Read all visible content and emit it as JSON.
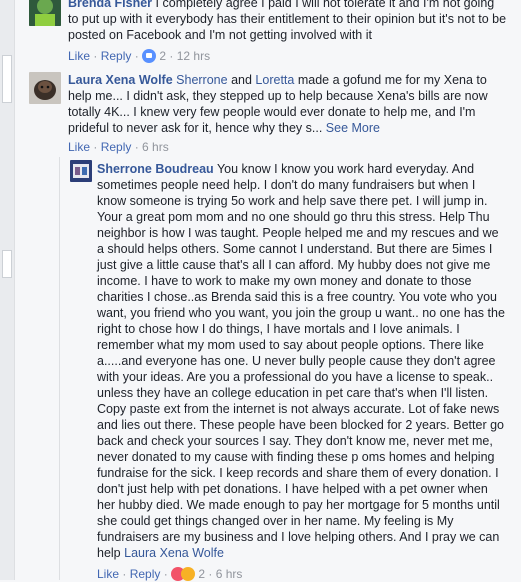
{
  "comments": [
    {
      "author": "Brenda Fisher",
      "text": "I completely agree I paid I will not tolerate it and I'm not going to put up with it everybody has their entitlement to their opinion but it's not to be posted on Facebook and I'm not getting involved with it",
      "actions": {
        "like": "Like",
        "reply": "Reply",
        "reaction_count": "2",
        "time": "12 hrs"
      }
    },
    {
      "author": "Laura Xena Wolfe",
      "mention1": "Sherrone",
      "and": "and",
      "mention2": "Loretta",
      "text": "made a gofund me for my Xena to help me... I didn't ask, they stepped up to help because Xena's bills are now totally 4K... I knew very few people would ever donate to help me, and I'm prideful to never ask for it, hence why they s...",
      "see_more": "See More",
      "actions": {
        "like": "Like",
        "reply": "Reply",
        "time": "6 hrs"
      }
    },
    {
      "author": "Sherrone Boudreau",
      "text": "You know I know you work hard everyday. And sometimes people need help. I don't do many fundraisers but when I know someone is trying 5o work and help save there pet. I will jump in. Your a great pom mom and no one should go thru this stress. Help Thu neighbor is how I was taught. People helped me and my rescues and we a should helps others. Some cannot I understand. But there are 5imes I just give a little cause that's all I can afford. My hubby does not give me income. I have to work to make my own money and donate to those charities I chose..as Brenda said this is a free country. You vote who you want, you friend who you want, you join the group u want.. no one has the right to chose how I do things, I have mortals and I love animals. I remember what my mom used to say about people options. There like a.....and everyone has one. U never bully people cause they don't agree with your ideas. Are you a professional do you have a license to speak.. unless they have an college education in pet care that's when I'll listen. Copy paste ext from the internet is not always accurate. Lot of fake news and lies out there. These people have been blocked for 2 years. Better go back and check your sources I say. They don't know me, never met me, never donated to my cause with finding these p oms homes and helping fundraise for the sick. I keep records and share them of every donation. I don't just help with pet donations. I have helped with a pet owner when her hubby died. We made enough to pay her mortgage for 5 months until she could get things changed over in her name. My feeling is My fundraisers are my business and I love helping others. And I pray we can help",
      "tag": "Laura Xena Wolfe",
      "actions": {
        "like": "Like",
        "reply": "Reply",
        "reaction_count": "2",
        "time": "6 hrs"
      }
    }
  ],
  "colors": {
    "link": "#365899",
    "action": "#4267b2",
    "meta": "#90949c",
    "text": "#1d2129"
  }
}
